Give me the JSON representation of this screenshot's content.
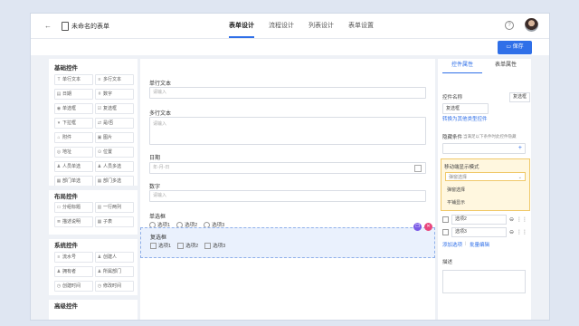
{
  "header": {
    "back_icon": "arrow-left",
    "title": "未命名的表单",
    "tabs": [
      "表单设计",
      "流程设计",
      "列表设计",
      "表单设置"
    ],
    "active_tab": 0,
    "help_icon": "?"
  },
  "toolbar": {
    "save_label": "保存"
  },
  "palette": {
    "groups": [
      {
        "title": "基础控件",
        "items": [
          {
            "icon": "T",
            "label": "单行文本"
          },
          {
            "icon": "≡",
            "label": "多行文本"
          },
          {
            "icon": "▤",
            "label": "日期"
          },
          {
            "icon": "#",
            "label": "数字"
          },
          {
            "icon": "◉",
            "label": "单选框"
          },
          {
            "icon": "☑",
            "label": "复选框"
          },
          {
            "icon": "▾",
            "label": "下拉框"
          },
          {
            "icon": "⇄",
            "label": "是/否"
          },
          {
            "icon": "⌂",
            "label": "附件"
          },
          {
            "icon": "▣",
            "label": "图片"
          },
          {
            "icon": "◎",
            "label": "地址"
          },
          {
            "icon": "⊙",
            "label": "位置"
          },
          {
            "icon": "♟",
            "label": "人员单选"
          },
          {
            "icon": "♟",
            "label": "人员多选"
          },
          {
            "icon": "▦",
            "label": "部门单选"
          },
          {
            "icon": "▦",
            "label": "部门多选"
          }
        ]
      },
      {
        "title": "布局控件",
        "items": [
          {
            "icon": "▭",
            "label": "分组标题"
          },
          {
            "icon": "▥",
            "label": "一行两列"
          },
          {
            "icon": "≣",
            "label": "描述说明"
          },
          {
            "icon": "▦",
            "label": "子表"
          }
        ]
      },
      {
        "title": "系统控件",
        "items": [
          {
            "icon": "≡",
            "label": "流水号"
          },
          {
            "icon": "♟",
            "label": "创建人"
          },
          {
            "icon": "♟",
            "label": "拥有者"
          },
          {
            "icon": "♟",
            "label": "所属部门"
          },
          {
            "icon": "◷",
            "label": "创建时间"
          },
          {
            "icon": "◷",
            "label": "修改时间"
          }
        ]
      },
      {
        "title": "高级控件",
        "items": []
      }
    ]
  },
  "form": {
    "fields": [
      {
        "label": "单行文本",
        "placeholder": "请输入"
      },
      {
        "label": "多行文本",
        "placeholder": "请输入"
      },
      {
        "label": "日期",
        "placeholder": "年-月-日"
      },
      {
        "label": "数字",
        "placeholder": "请输入"
      }
    ],
    "radio": {
      "label": "单选框",
      "options": [
        "选项1",
        "选项2",
        "选项3"
      ]
    },
    "checkbox": {
      "label": "复选框",
      "options": [
        "选项1",
        "选项2",
        "选项3"
      ]
    },
    "selected_actions": [
      "copy-icon",
      "delete-icon"
    ]
  },
  "properties": {
    "tabs": [
      "控件属性",
      "表单属性"
    ],
    "active_tab": 0,
    "name_label": "控件名称",
    "name_tag": "复选框",
    "name_value": "复选框",
    "convert_link": "转换为其他类型控件",
    "hidden_label": "隐藏条件",
    "hidden_hint": "当满足以下条件时此控件隐藏",
    "add_icon": "+",
    "mobile_label": "移动端显示模式",
    "mobile_select": "弹窗选择",
    "mobile_options": [
      "弹窗选择",
      "平铺显示"
    ],
    "option_rows": [
      "选项2",
      "选项3"
    ],
    "add_option": "添加选项",
    "bulk_edit": "批量编辑",
    "divider": "|",
    "desc_label": "描述",
    "colors": {
      "primary": "#2f6fe8",
      "highlight": "#fff7df",
      "highlight_border": "#f0c96a",
      "danger": "#e8467c",
      "copy": "#7b5be6"
    }
  }
}
